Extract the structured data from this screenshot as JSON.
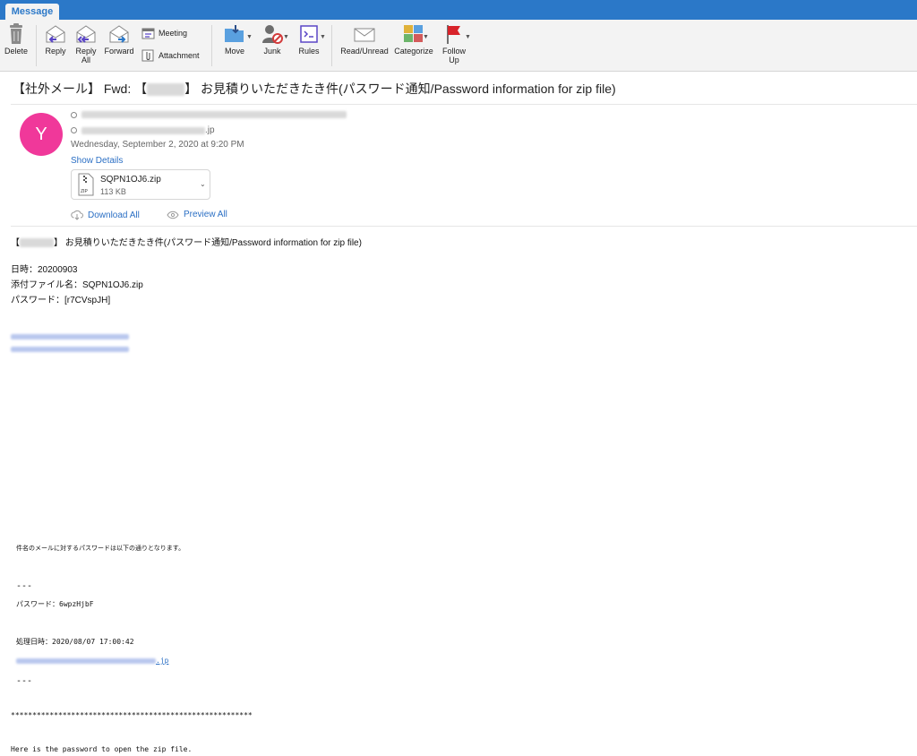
{
  "ribbon": {
    "active_tab": "Message",
    "buttons": {
      "delete": "Delete",
      "reply": "Reply",
      "reply_all_1": "Reply",
      "reply_all_2": "All",
      "forward": "Forward",
      "meeting": "Meeting",
      "attachment": "Attachment",
      "move": "Move",
      "junk": "Junk",
      "rules": "Rules",
      "read_unread": "Read/Unread",
      "categorize": "Categorize",
      "follow_up_1": "Follow",
      "follow_up_2": "Up"
    }
  },
  "email": {
    "subject_prefix": "【社外メール】 Fwd: 【",
    "subject_suffix": "】 お見積りいただきたき件(パスワード通知/Password information for zip file)",
    "sender_initial": "Y",
    "address2_suffix": ".jp",
    "date": "Wednesday, September 2, 2020 at 9:20 PM",
    "show_details": "Show Details",
    "attachment": {
      "name": "SQPN1OJ6.zip",
      "size": "113 KB",
      "type_badge": "ZIP"
    },
    "download_all": "Download All",
    "preview_all": "Preview All"
  },
  "body": {
    "heading_prefix": "【",
    "heading_suffix": "】 お見積りいただきたき件(パスワード通知/Password information for zip file)",
    "datetime_line": "日時：20200903",
    "filename_line": "添付ファイル名：SQPN1OJ6.zip",
    "password_line": "パスワード：[r7CVspJH]",
    "forward_intro": "件名のメールに対するパスワードは以下の通りとなります。",
    "dashes_1": "---",
    "forward_password": "パスワード：6wpzHjbF",
    "processed_at": "処理日時：2020/08/07 17:00:42",
    "link_suffix": ".jp",
    "dashes_2": "---",
    "stars": "********************************************************",
    "english_line": "Here is the password to open the zip file."
  },
  "colors": {
    "ribbon_blue": "#2b78c8",
    "avatar_pink": "#f0389a",
    "link_blue": "#2b6fc4"
  }
}
